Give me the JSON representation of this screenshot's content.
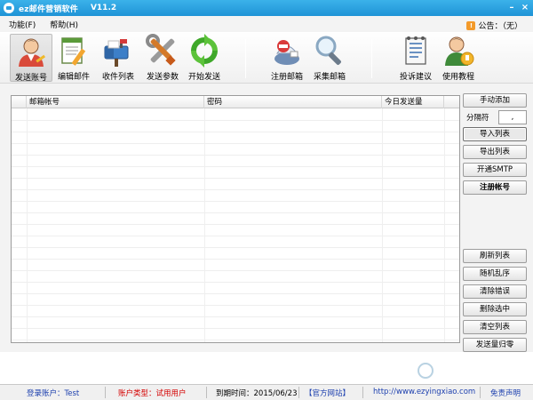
{
  "window": {
    "title": "ez邮件营销软件",
    "version": "V11.2",
    "minimize_label": "–",
    "close_label": "×"
  },
  "menu": {
    "items": [
      {
        "label": "功能(F)"
      },
      {
        "label": "帮助(H)"
      }
    ],
    "announcement": "公告：（无）"
  },
  "toolbar": {
    "items": [
      {
        "label": "发送账号",
        "icon": "user-icon"
      },
      {
        "label": "编辑邮件",
        "icon": "edit-document-icon"
      },
      {
        "label": "收件列表",
        "icon": "mailbox-icon"
      },
      {
        "label": "发送参数",
        "icon": "tools-icon"
      },
      {
        "label": "开始发送",
        "icon": "refresh-icon"
      },
      {
        "label": "注册邮箱",
        "icon": "register-mail-icon"
      },
      {
        "label": "采集邮箱",
        "icon": "search-icon"
      },
      {
        "label": "投诉建议",
        "icon": "notepad-icon"
      },
      {
        "label": "使用教程",
        "icon": "user-help-icon"
      }
    ]
  },
  "table": {
    "columns": [
      "邮箱帐号",
      "密码",
      "今日发送量"
    ],
    "rows": []
  },
  "side": {
    "manual_add": "手动添加",
    "separator_label": "分隔符",
    "separator_value": ",",
    "import_list": "导入列表",
    "export_list": "导出列表",
    "enable_smtp": "开通SMTP",
    "register_account": "注册帐号",
    "refresh_list": "刷新列表",
    "shuffle": "随机乱序",
    "clear_errors": "清除错误",
    "delete_selected": "删除选中",
    "clear_list": "清空列表",
    "reset_count": "发送量归零"
  },
  "status": {
    "login": "登录账户：Test",
    "account_type": "账户类型：试用用户",
    "expiry": "到期时间：2015/06/23",
    "official_label": "【官方网站】",
    "url": "http://www.ezyingxiao.com",
    "disclaimer": "免责声明"
  },
  "colors": {
    "titlebar": "#2aa1e2",
    "link": "#1c3fae",
    "trial_red": "#d40000"
  }
}
